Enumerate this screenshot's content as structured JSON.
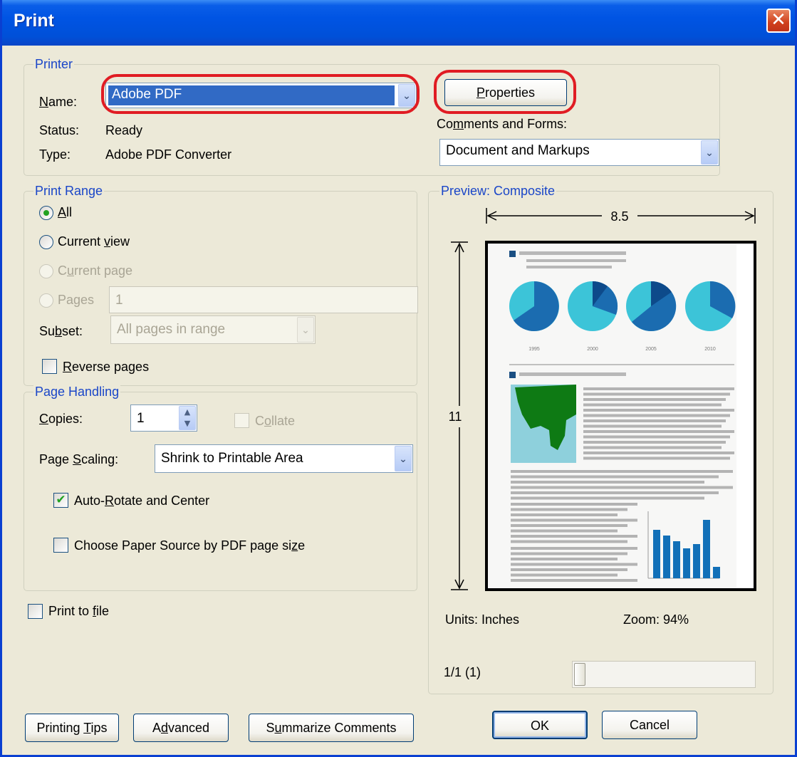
{
  "window": {
    "title": "Print",
    "close_glyph": "✕"
  },
  "printer": {
    "group_title": "Printer",
    "name_label": "Name:",
    "name_value": "Adobe PDF",
    "status_label": "Status:",
    "status_value": "Ready",
    "type_label": "Type:",
    "type_value": "Adobe PDF Converter",
    "properties_button": "Properties",
    "comments_label": "Comments and Forms:",
    "comments_value": "Document and Markups"
  },
  "print_range": {
    "group_title": "Print Range",
    "all": "All",
    "current_view": "Current view",
    "current_page": "Current page",
    "pages": "Pages",
    "pages_value": "1",
    "subset_label": "Subset:",
    "subset_value": "All pages in range",
    "reverse_pages": "Reverse pages",
    "selected": "all"
  },
  "page_handling": {
    "group_title": "Page Handling",
    "copies_label": "Copies:",
    "copies_value": "1",
    "collate": "Collate",
    "scaling_label": "Page Scaling:",
    "scaling_value": "Shrink to Printable Area",
    "auto_rotate": "Auto-Rotate and Center",
    "auto_rotate_checked": true,
    "paper_source": "Choose Paper Source by PDF page size",
    "paper_source_checked": false
  },
  "print_to_file": "Print to file",
  "preview": {
    "group_title": "Preview: Composite",
    "width": "8.5",
    "height": "11",
    "units": "Units: Inches",
    "zoom": "Zoom:  94%",
    "page_indicator": "1/1 (1)",
    "pie_years": [
      "1995",
      "2000",
      "2005",
      "2010"
    ]
  },
  "buttons": {
    "printing_tips": "Printing Tips",
    "advanced": "Advanced",
    "summarize": "Summarize Comments",
    "ok": "OK",
    "cancel": "Cancel"
  },
  "colors": {
    "title_bar": "#0054e3",
    "highlight_ring": "#e01c23",
    "group_title": "#1a46c8",
    "selection": "#316ac5"
  }
}
